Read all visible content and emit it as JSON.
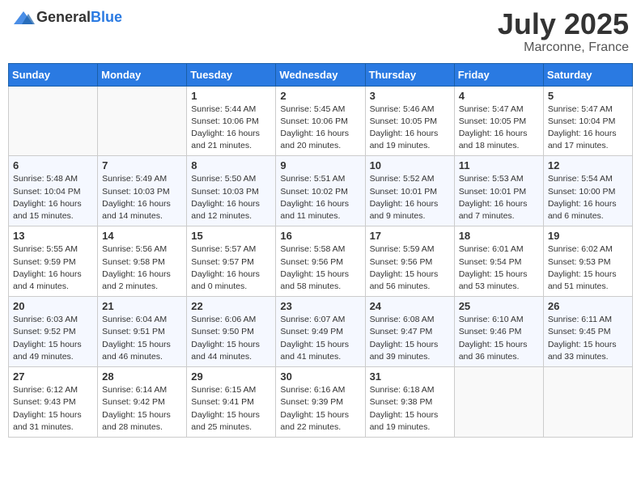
{
  "header": {
    "logo_text_general": "General",
    "logo_text_blue": "Blue",
    "month": "July 2025",
    "location": "Marconne, France"
  },
  "weekdays": [
    "Sunday",
    "Monday",
    "Tuesday",
    "Wednesday",
    "Thursday",
    "Friday",
    "Saturday"
  ],
  "weeks": [
    [
      {
        "day": "",
        "info": ""
      },
      {
        "day": "",
        "info": ""
      },
      {
        "day": "1",
        "info": "Sunrise: 5:44 AM\nSunset: 10:06 PM\nDaylight: 16 hours and 21 minutes."
      },
      {
        "day": "2",
        "info": "Sunrise: 5:45 AM\nSunset: 10:06 PM\nDaylight: 16 hours and 20 minutes."
      },
      {
        "day": "3",
        "info": "Sunrise: 5:46 AM\nSunset: 10:05 PM\nDaylight: 16 hours and 19 minutes."
      },
      {
        "day": "4",
        "info": "Sunrise: 5:47 AM\nSunset: 10:05 PM\nDaylight: 16 hours and 18 minutes."
      },
      {
        "day": "5",
        "info": "Sunrise: 5:47 AM\nSunset: 10:04 PM\nDaylight: 16 hours and 17 minutes."
      }
    ],
    [
      {
        "day": "6",
        "info": "Sunrise: 5:48 AM\nSunset: 10:04 PM\nDaylight: 16 hours and 15 minutes."
      },
      {
        "day": "7",
        "info": "Sunrise: 5:49 AM\nSunset: 10:03 PM\nDaylight: 16 hours and 14 minutes."
      },
      {
        "day": "8",
        "info": "Sunrise: 5:50 AM\nSunset: 10:03 PM\nDaylight: 16 hours and 12 minutes."
      },
      {
        "day": "9",
        "info": "Sunrise: 5:51 AM\nSunset: 10:02 PM\nDaylight: 16 hours and 11 minutes."
      },
      {
        "day": "10",
        "info": "Sunrise: 5:52 AM\nSunset: 10:01 PM\nDaylight: 16 hours and 9 minutes."
      },
      {
        "day": "11",
        "info": "Sunrise: 5:53 AM\nSunset: 10:01 PM\nDaylight: 16 hours and 7 minutes."
      },
      {
        "day": "12",
        "info": "Sunrise: 5:54 AM\nSunset: 10:00 PM\nDaylight: 16 hours and 6 minutes."
      }
    ],
    [
      {
        "day": "13",
        "info": "Sunrise: 5:55 AM\nSunset: 9:59 PM\nDaylight: 16 hours and 4 minutes."
      },
      {
        "day": "14",
        "info": "Sunrise: 5:56 AM\nSunset: 9:58 PM\nDaylight: 16 hours and 2 minutes."
      },
      {
        "day": "15",
        "info": "Sunrise: 5:57 AM\nSunset: 9:57 PM\nDaylight: 16 hours and 0 minutes."
      },
      {
        "day": "16",
        "info": "Sunrise: 5:58 AM\nSunset: 9:56 PM\nDaylight: 15 hours and 58 minutes."
      },
      {
        "day": "17",
        "info": "Sunrise: 5:59 AM\nSunset: 9:56 PM\nDaylight: 15 hours and 56 minutes."
      },
      {
        "day": "18",
        "info": "Sunrise: 6:01 AM\nSunset: 9:54 PM\nDaylight: 15 hours and 53 minutes."
      },
      {
        "day": "19",
        "info": "Sunrise: 6:02 AM\nSunset: 9:53 PM\nDaylight: 15 hours and 51 minutes."
      }
    ],
    [
      {
        "day": "20",
        "info": "Sunrise: 6:03 AM\nSunset: 9:52 PM\nDaylight: 15 hours and 49 minutes."
      },
      {
        "day": "21",
        "info": "Sunrise: 6:04 AM\nSunset: 9:51 PM\nDaylight: 15 hours and 46 minutes."
      },
      {
        "day": "22",
        "info": "Sunrise: 6:06 AM\nSunset: 9:50 PM\nDaylight: 15 hours and 44 minutes."
      },
      {
        "day": "23",
        "info": "Sunrise: 6:07 AM\nSunset: 9:49 PM\nDaylight: 15 hours and 41 minutes."
      },
      {
        "day": "24",
        "info": "Sunrise: 6:08 AM\nSunset: 9:47 PM\nDaylight: 15 hours and 39 minutes."
      },
      {
        "day": "25",
        "info": "Sunrise: 6:10 AM\nSunset: 9:46 PM\nDaylight: 15 hours and 36 minutes."
      },
      {
        "day": "26",
        "info": "Sunrise: 6:11 AM\nSunset: 9:45 PM\nDaylight: 15 hours and 33 minutes."
      }
    ],
    [
      {
        "day": "27",
        "info": "Sunrise: 6:12 AM\nSunset: 9:43 PM\nDaylight: 15 hours and 31 minutes."
      },
      {
        "day": "28",
        "info": "Sunrise: 6:14 AM\nSunset: 9:42 PM\nDaylight: 15 hours and 28 minutes."
      },
      {
        "day": "29",
        "info": "Sunrise: 6:15 AM\nSunset: 9:41 PM\nDaylight: 15 hours and 25 minutes."
      },
      {
        "day": "30",
        "info": "Sunrise: 6:16 AM\nSunset: 9:39 PM\nDaylight: 15 hours and 22 minutes."
      },
      {
        "day": "31",
        "info": "Sunrise: 6:18 AM\nSunset: 9:38 PM\nDaylight: 15 hours and 19 minutes."
      },
      {
        "day": "",
        "info": ""
      },
      {
        "day": "",
        "info": ""
      }
    ]
  ]
}
